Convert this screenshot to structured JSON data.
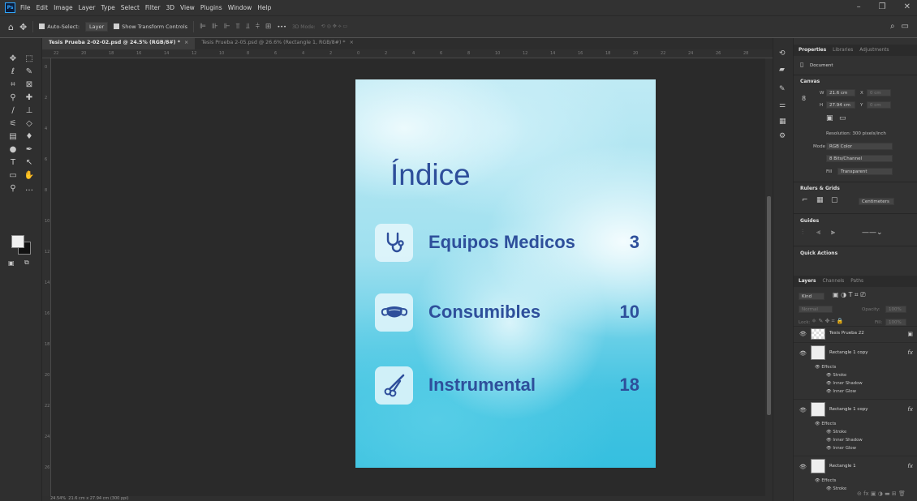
{
  "app": {
    "logo": "Ps"
  },
  "menu": [
    "File",
    "Edit",
    "Image",
    "Layer",
    "Type",
    "Select",
    "Filter",
    "3D",
    "View",
    "Plugins",
    "Window",
    "Help"
  ],
  "window_controls": {
    "minimize": "–",
    "maximize": "❐",
    "close": "✕"
  },
  "options": {
    "auto_select_label": "Auto-Select:",
    "auto_select_value": "Layer",
    "show_transform_label": "Show Transform Controls",
    "mode_3d_label": "3D Mode:"
  },
  "tabs": [
    {
      "label": "Tesis Prueba 2-02-02.psd @ 24.5% (RGB/8#) *",
      "active": true
    },
    {
      "label": "Tesis Prueba 2-05.psd @ 26.6% (Rectangle 1, RGB/8#) *",
      "active": false
    }
  ],
  "statusbar": {
    "zoom": "24.54%",
    "size": "21.6 cm x 27.94 cm (300 ppi)"
  },
  "document": {
    "title": "Índice",
    "items": [
      {
        "label": "Equipos Medicos",
        "page": "3",
        "icon": "stethoscope-icon"
      },
      {
        "label": "Consumibles",
        "page": "10",
        "icon": "mask-icon"
      },
      {
        "label": "Instrumental",
        "page": "18",
        "icon": "scissors-icon"
      }
    ],
    "colors": {
      "text": "#2e4f9b",
      "bg_light": "#d8f3fa",
      "bg_dark": "#35bfdf"
    }
  },
  "properties": {
    "tabs": [
      "Properties",
      "Libraries",
      "Adjustments"
    ],
    "doc_label": "Document",
    "canvas": {
      "header": "Canvas",
      "w_label": "W",
      "w_value": "21.6 cm",
      "h_label": "H",
      "h_value": "27.94 cm",
      "x_label": "X",
      "x_value": "0 cm",
      "y_label": "Y",
      "y_value": "0 cm",
      "resolution": "Resolution: 300 pixels/inch",
      "mode_label": "Mode",
      "mode_value": "RGB Color",
      "bits_value": "8 Bits/Channel",
      "fill_label": "Fill",
      "fill_value": "Transparent"
    },
    "rulers_header": "Rulers & Grids",
    "units_value": "Centimeters",
    "guides_header": "Guides",
    "quick_actions_header": "Quick Actions"
  },
  "layers": {
    "tabs": [
      "Layers",
      "Channels",
      "Paths"
    ],
    "kind_label": "Kind",
    "blend_mode": "Normal",
    "opacity_label": "Opacity:",
    "opacity_value": "100%",
    "lock_label": "Lock:",
    "fill_label": "Fill:",
    "fill_value": "100%",
    "rows": [
      {
        "name": "Tesis Prueba 22",
        "fx": ""
      },
      {
        "name": "Rectangle 1 copy",
        "fx": "fx",
        "effects_label": "Effects",
        "effects": [
          "Stroke",
          "Inner Shadow",
          "Inner Glow"
        ]
      },
      {
        "name": "Rectangle 1 copy",
        "fx": "fx",
        "effects_label": "Effects",
        "effects": [
          "Stroke",
          "Inner Shadow",
          "Inner Glow"
        ]
      },
      {
        "name": "Rectangle 1",
        "fx": "fx",
        "effects_label": "Effects",
        "effects": [
          "Stroke"
        ]
      }
    ]
  }
}
